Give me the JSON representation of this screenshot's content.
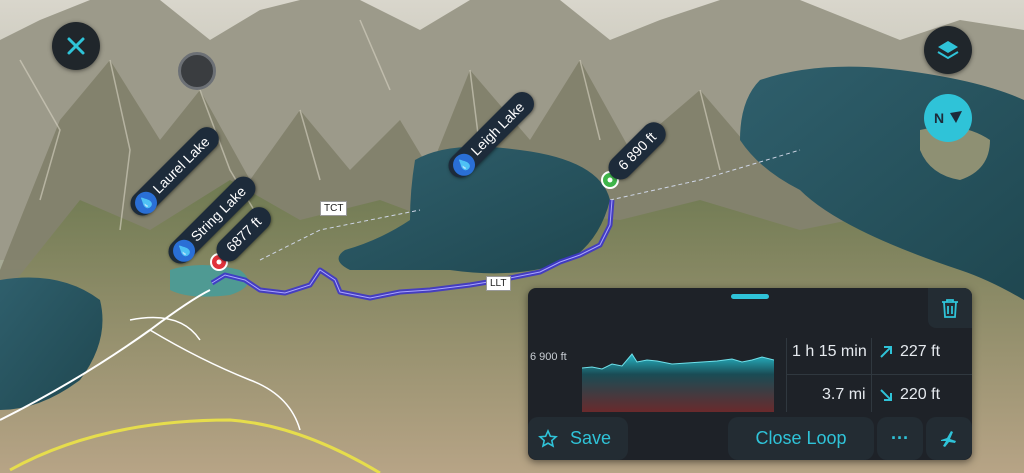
{
  "map": {
    "lakes": [
      {
        "name": "Laurel Lake",
        "icon": "water-drop-icon"
      },
      {
        "name": "String Lake",
        "icon": "water-drop-icon"
      },
      {
        "name": "Leigh Lake",
        "icon": "water-drop-icon"
      }
    ],
    "start_marker": {
      "label": "6877 ft",
      "color": "#e0323b"
    },
    "end_marker": {
      "label": "6 890 ft",
      "color": "#3fb54a"
    },
    "trail_tags": [
      "TCT",
      "LLT"
    ],
    "route_color": "#3d35c9"
  },
  "controls": {
    "close_icon": "close-icon",
    "layers_icon": "layers-icon",
    "compass_label": "N",
    "accent": "#2fc3d8"
  },
  "panel": {
    "elevation_axis_label": "6 900 ft",
    "duration": "1 h 15 min",
    "distance": "3.7 mi",
    "ascent": "227 ft",
    "descent": "220 ft",
    "save_label": "Save",
    "close_loop_label": "Close Loop",
    "more_label": "···"
  }
}
